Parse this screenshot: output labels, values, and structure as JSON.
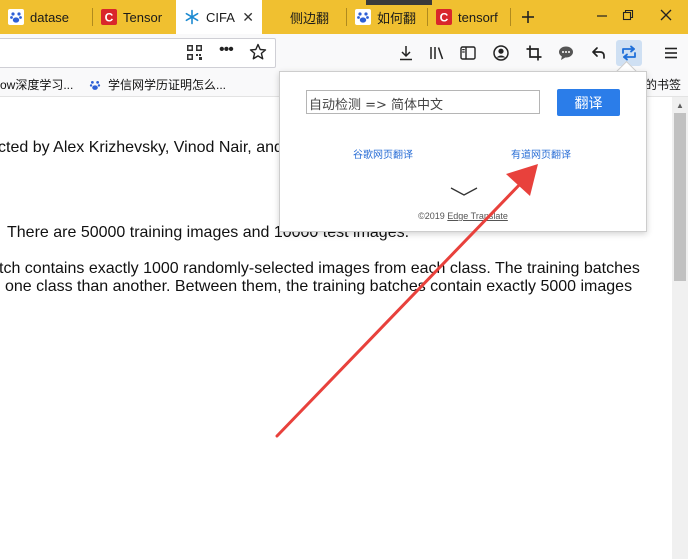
{
  "tabs": [
    {
      "label": "datase",
      "icon": "baidu-paw-icon",
      "active": false
    },
    {
      "label": "Tensor",
      "icon": "csdn-icon",
      "active": false
    },
    {
      "label": "CIFA",
      "icon": "snowflake-icon",
      "active": true
    },
    {
      "label": "侧边翻",
      "icon": "",
      "active": false
    },
    {
      "label": "如何翻",
      "icon": "baidu-paw-icon",
      "active": false
    },
    {
      "label": "tensorf",
      "icon": "csdn-icon",
      "active": false
    }
  ],
  "bookmarks": [
    {
      "label": "ow深度学习...",
      "icon": ""
    },
    {
      "label": "学信网学历证明怎么...",
      "icon": "baidu-paw-icon"
    },
    {
      "label": "的书签",
      "icon": ""
    }
  ],
  "content": {
    "line1": "cted by Alex Krizhevsky, Vinod Nair, and",
    "line2": "There are 50000 training images and 10000 test images.",
    "line3": "tch contains exactly 1000 randomly-selected images from each class. The training batches",
    "line4": "one class than another. Between them, the training batches contain exactly 5000 images"
  },
  "popup": {
    "input_value": "自动检测 => 简体中文",
    "translate_button": "翻译",
    "google_link": "谷歌网页翻译",
    "youdao_link": "有道网页翻译",
    "copyright_prefix": "©2019 ",
    "copyright_link": "Edge Translate"
  },
  "colors": {
    "tabbar": "#f0c030",
    "accent": "#2b7de9",
    "arrow": "#e8413c"
  }
}
